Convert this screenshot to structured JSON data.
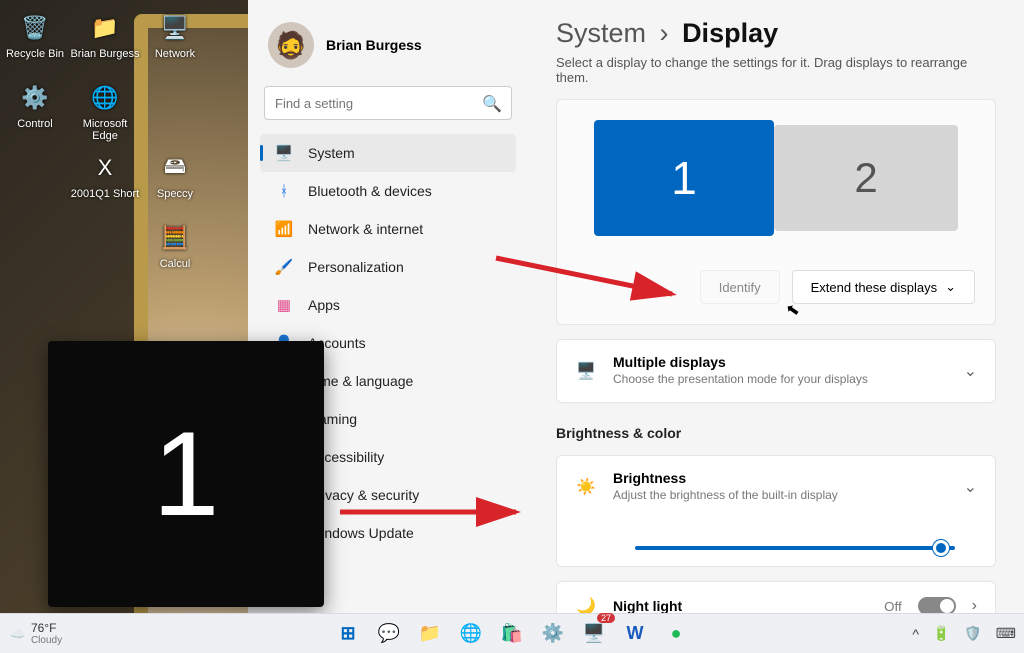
{
  "desktop": {
    "icons": [
      {
        "label": "Recycle Bin",
        "glyph": "🗑️"
      },
      {
        "label": "Brian Burgess",
        "glyph": "📁"
      },
      {
        "label": "Network",
        "glyph": "🖥️"
      },
      {
        "label": "Control",
        "glyph": "⚙️"
      },
      {
        "label": "Microsoft Edge",
        "glyph": "🌐"
      },
      {
        "label": "",
        "glyph": ""
      },
      {
        "label": "",
        "glyph": ""
      },
      {
        "label": "2001Q1 Short",
        "glyph": "X"
      },
      {
        "label": "Speccy",
        "glyph": "🖴"
      },
      {
        "label": "",
        "glyph": ""
      },
      {
        "label": "",
        "glyph": ""
      },
      {
        "label": "Calcul",
        "glyph": "🧮"
      }
    ]
  },
  "user": {
    "name": "Brian Burgess",
    "email": " "
  },
  "search": {
    "placeholder": "Find a setting"
  },
  "nav": [
    {
      "icon": "🖥️",
      "label": "System",
      "active": true
    },
    {
      "icon": "ᚼ",
      "label": "Bluetooth & devices",
      "color": "#1a73e8"
    },
    {
      "icon": "📶",
      "label": "Network & internet",
      "color": "#1a9be8"
    },
    {
      "icon": "🖌️",
      "label": "Personalization"
    },
    {
      "icon": "▦",
      "label": "Apps",
      "color": "#e24a8b"
    },
    {
      "icon": "👤",
      "label": "Accounts"
    },
    {
      "icon": "🕒",
      "label": "Time & language"
    },
    {
      "icon": "🎮",
      "label": "Gaming"
    },
    {
      "icon": "♿",
      "label": "Accessibility"
    },
    {
      "icon": "🛡️",
      "label": "Privacy & security"
    },
    {
      "icon": "🔄",
      "label": "Windows Update"
    }
  ],
  "breadcrumb": {
    "root": "System",
    "sep": "›",
    "page": "Display"
  },
  "subtitle": "Select a display to change the settings for it. Drag displays to rearrange them.",
  "displays": {
    "d1": "1",
    "d2": "2"
  },
  "buttons": {
    "identify": "Identify",
    "extend": "Extend these displays"
  },
  "multi": {
    "title": "Multiple displays",
    "desc": "Choose the presentation mode for your displays"
  },
  "section_bc": "Brightness & color",
  "brightness": {
    "title": "Brightness",
    "desc": "Adjust the brightness of the built-in display",
    "value": 98
  },
  "night": {
    "title": "Night light",
    "state": "Off"
  },
  "identify_overlay": "1",
  "taskbar": {
    "temp": "76°F",
    "cond": "Cloudy",
    "apps": [
      {
        "name": "start",
        "glyph": "⊞",
        "color": "#0067c0"
      },
      {
        "name": "chat",
        "glyph": "💬",
        "color": "#5b5fc7"
      },
      {
        "name": "explorer",
        "glyph": "📁",
        "color": "#f7c948"
      },
      {
        "name": "edge",
        "glyph": "🌐",
        "color": "#1a73e8"
      },
      {
        "name": "store",
        "glyph": "🛍️",
        "color": "#0067c0"
      },
      {
        "name": "settings",
        "glyph": "⚙️",
        "color": "#555"
      },
      {
        "name": "screens",
        "glyph": "🖥️",
        "color": "#1a9be8",
        "badge": "27"
      },
      {
        "name": "word",
        "glyph": "W",
        "color": "#185abd"
      },
      {
        "name": "spotify",
        "glyph": "●",
        "color": "#1db954"
      }
    ],
    "tray": [
      "^",
      "🔋",
      "🛡️",
      "⌨"
    ]
  }
}
